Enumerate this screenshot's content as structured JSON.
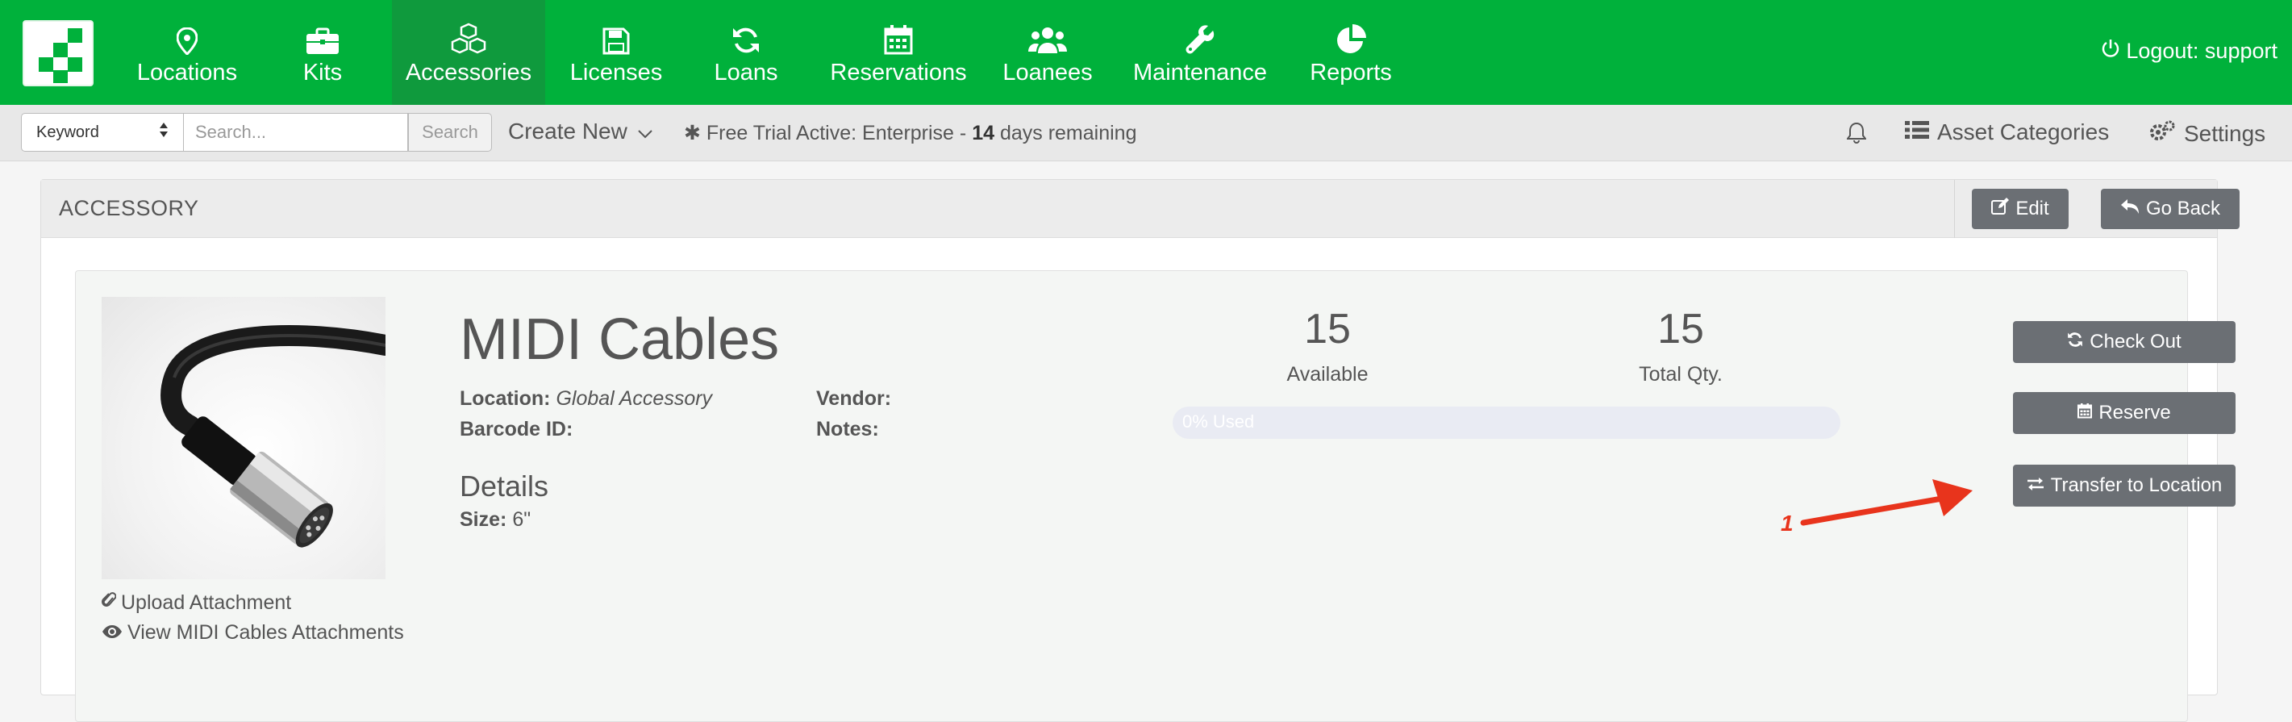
{
  "nav": {
    "items": [
      {
        "label": "Locations",
        "icon": "map-marker-icon"
      },
      {
        "label": "Kits",
        "icon": "briefcase-icon"
      },
      {
        "label": "Accessories",
        "icon": "cubes-icon",
        "active": true
      },
      {
        "label": "Licenses",
        "icon": "floppy-disk-icon"
      },
      {
        "label": "Loans",
        "icon": "refresh-icon"
      },
      {
        "label": "Reservations",
        "icon": "calendar-icon"
      },
      {
        "label": "Loanees",
        "icon": "users-icon"
      },
      {
        "label": "Maintenance",
        "icon": "wrench-icon"
      },
      {
        "label": "Reports",
        "icon": "pie-chart-icon"
      }
    ],
    "logout_label": "Logout: support",
    "brand_color": "#00b13b"
  },
  "subbar": {
    "search_type": "Keyword",
    "search_placeholder": "Search...",
    "search_button": "Search",
    "create_new": "Create New",
    "trial_prefix": "Free Trial Active: Enterprise - ",
    "trial_days": "14",
    "trial_suffix": " days remaining",
    "asset_categories": "Asset Categories",
    "settings": "Settings"
  },
  "panel": {
    "title": "ACCESSORY",
    "edit_button": "Edit",
    "go_back_button": "Go Back"
  },
  "item": {
    "name": "MIDI Cables",
    "location_label": "Location:",
    "location_value": "Global Accessory",
    "barcode_label": "Barcode ID:",
    "barcode_value": "",
    "vendor_label": "Vendor:",
    "vendor_value": "",
    "notes_label": "Notes:",
    "notes_value": "",
    "details_heading": "Details",
    "size_label": "Size:",
    "size_value": "6\"",
    "upload_attachment": "Upload Attachment",
    "view_attachments": "View MIDI Cables Attachments"
  },
  "stats": {
    "available_value": "15",
    "available_label": "Available",
    "total_value": "15",
    "total_label": "Total Qty.",
    "used_percent": 0,
    "used_text": "0% Used"
  },
  "actions": {
    "check_out": "Check Out",
    "reserve": "Reserve",
    "transfer": "Transfer to Location"
  },
  "annotation": {
    "number": "1",
    "color": "#e8341c"
  }
}
